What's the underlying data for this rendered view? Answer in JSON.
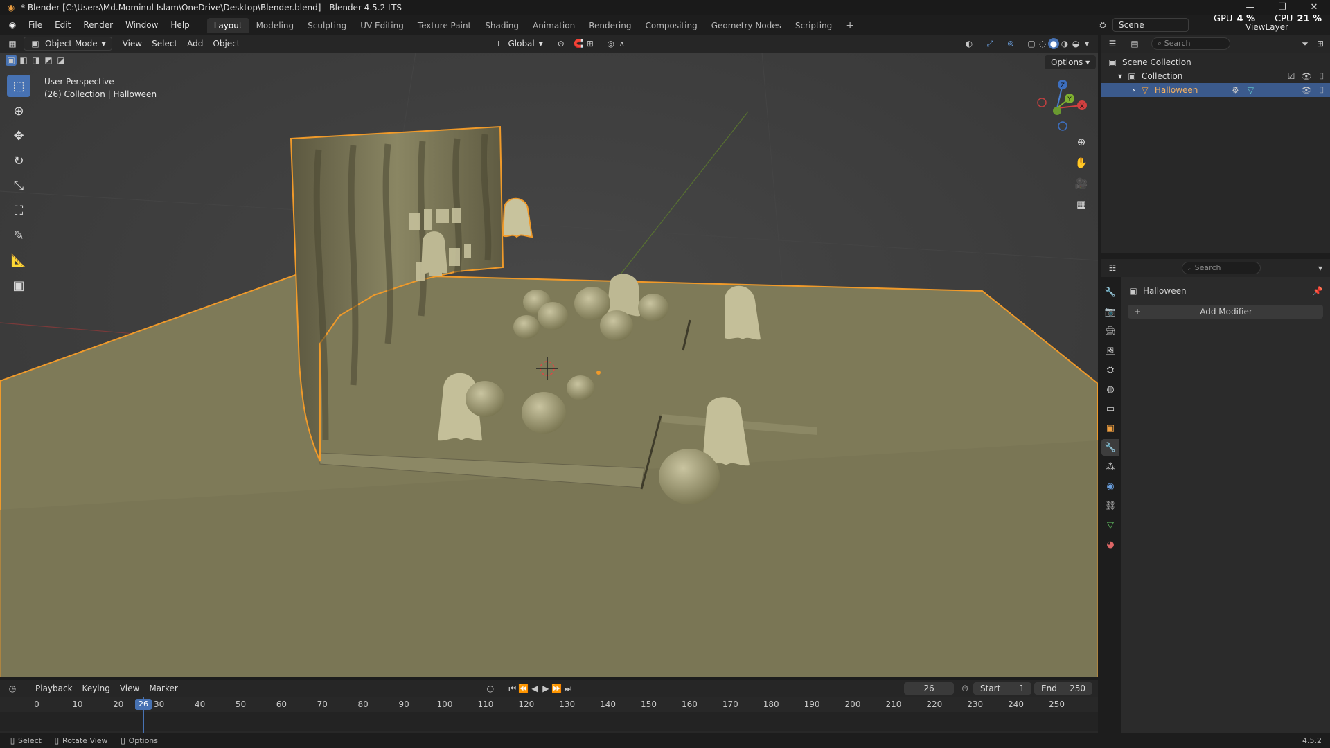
{
  "window": {
    "title": "* Blender [C:\\Users\\Md.Mominul Islam\\OneDrive\\Desktop\\Blender.blend] - Blender 4.5.2 LTS",
    "controls": [
      "—",
      "❐",
      "✕"
    ]
  },
  "menubar": {
    "items": [
      "File",
      "Edit",
      "Render",
      "Window",
      "Help"
    ],
    "workspaces": [
      "Layout",
      "Modeling",
      "Sculpting",
      "UV Editing",
      "Texture Paint",
      "Shading",
      "Animation",
      "Rendering",
      "Compositing",
      "Geometry Nodes",
      "Scripting"
    ],
    "active_workspace": "Layout",
    "add_tab": "+",
    "scene_label": "Scene",
    "gpu_label": "GPU",
    "gpu_value": "4 %",
    "cpu_label": "CPU",
    "cpu_value": "21 %",
    "view_layer_label": "ViewLayer"
  },
  "viewport_header": {
    "mode": "Object Mode",
    "menus": [
      "View",
      "Select",
      "Add",
      "Object"
    ],
    "transform_orientation": "Global",
    "options_label": "Options"
  },
  "viewport": {
    "perspective": "User Perspective",
    "collection_info": "(26) Collection | Halloween",
    "gizmo_axes": {
      "x": "X",
      "y": "Y",
      "z": "Z"
    },
    "accent_color": "#f09a2a"
  },
  "outliner": {
    "search_placeholder": "Search",
    "rows": [
      {
        "label": "Scene Collection"
      },
      {
        "label": "Collection"
      },
      {
        "label": "Halloween"
      }
    ]
  },
  "properties": {
    "search_placeholder": "Search",
    "object_name": "Halloween",
    "add_modifier_label": "Add Modifier"
  },
  "timeline": {
    "menus": [
      "Playback",
      "Keying",
      "View",
      "Marker"
    ],
    "current_frame": "26",
    "start_label": "Start",
    "start_value": "1",
    "end_label": "End",
    "end_value": "250",
    "ticks": [
      "0",
      "10",
      "20",
      "30",
      "40",
      "50",
      "60",
      "70",
      "80",
      "90",
      "100",
      "110",
      "120",
      "130",
      "140",
      "150",
      "160",
      "170",
      "180",
      "190",
      "200",
      "210",
      "220",
      "230",
      "240",
      "250"
    ]
  },
  "statusbar": {
    "items": [
      "Select",
      "Rotate View",
      "Options"
    ],
    "version": "4.5.2"
  }
}
